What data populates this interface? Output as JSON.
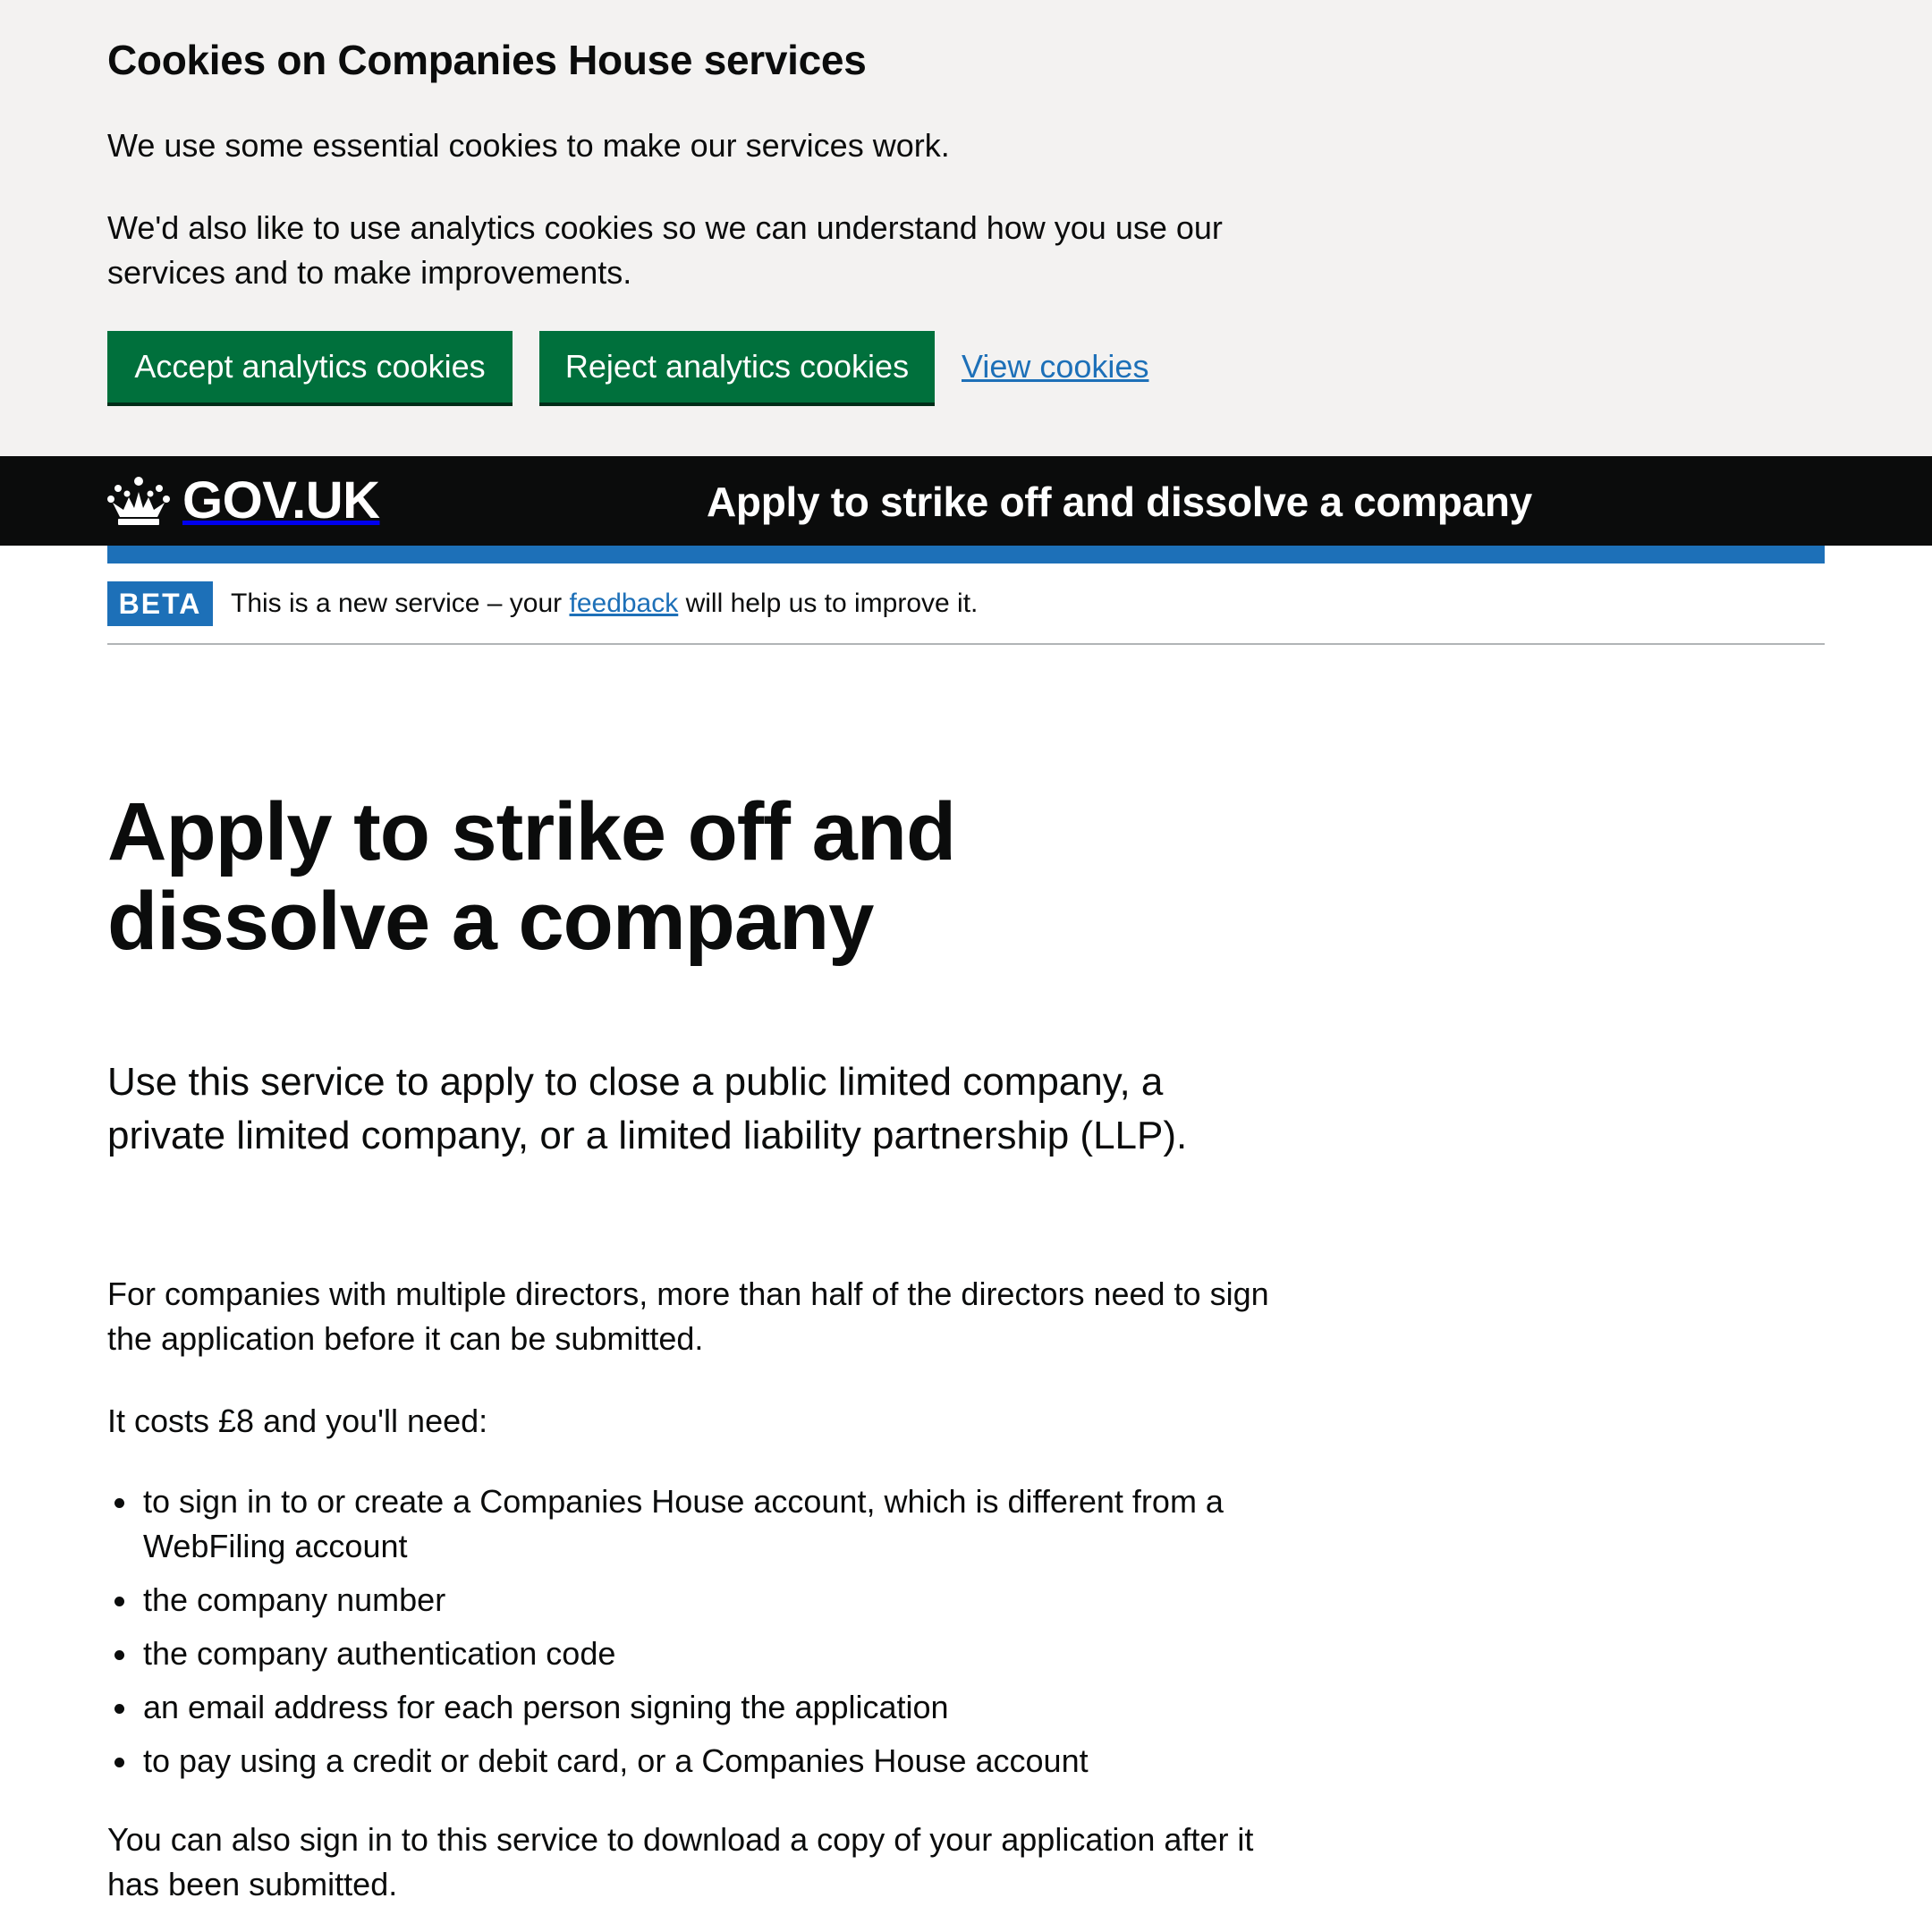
{
  "cookie_banner": {
    "title": "Cookies on Companies House services",
    "paragraph_1": "We use some essential cookies to make our services work.",
    "paragraph_2": "We'd also like to use analytics cookies so we can understand how you use our services and to make improvements.",
    "accept_label": "Accept analytics cookies",
    "reject_label": "Reject analytics cookies",
    "view_label": "View cookies"
  },
  "header": {
    "logo_text": "GOV.UK",
    "logo_icon": "crown-icon",
    "service_name": "Apply to strike off and dissolve a company"
  },
  "phase_banner": {
    "tag": "BETA",
    "text_before": "This is a new service – your ",
    "link": "feedback",
    "text_after": " will help us to improve it."
  },
  "main": {
    "heading": "Apply to strike off and dissolve a company",
    "lead": "Use this service to apply to close a public limited company, a private limited company, or a limited liability partnership (LLP).",
    "directors_para": "For companies with multiple directors, more than half of the directors need to sign the application before it can be submitted.",
    "costs_para": "It costs £8 and you'll need:",
    "requirements": [
      "to sign in to or create a Companies House account, which is different from a WebFiling account",
      "the company number",
      "the company authentication code",
      "an email address for each person signing the application",
      "to pay using a credit or debit card, or a Companies House account"
    ],
    "signin_para": "You can also sign in to this service to download a copy of your application after it has been submitted."
  },
  "colors": {
    "banner_bg": "#f3f2f1",
    "button_green": "#00703c",
    "link_blue": "#1d70b8",
    "header_black": "#0b0c0c"
  }
}
